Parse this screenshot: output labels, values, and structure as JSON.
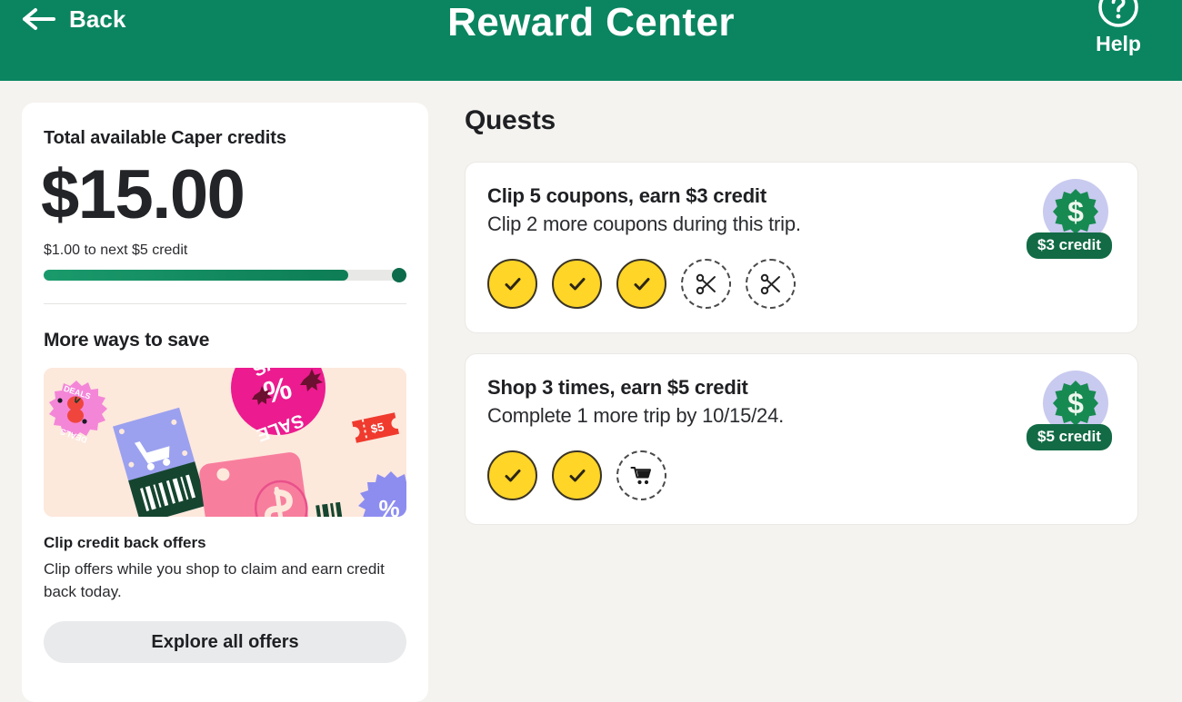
{
  "header": {
    "back_label": "Back",
    "title": "Reward Center",
    "help_label": "Help",
    "back_icon": "arrow-left-icon",
    "help_icon": "question-circle-icon",
    "background_color": "#0a8560"
  },
  "credits_card": {
    "label": "Total available Caper credits",
    "amount": "$15.00",
    "progress_caption": "$1.00 to next $5 credit",
    "progress_percent": 84,
    "progress_fill_color": "#0d7d55",
    "progress_track_color": "#e8e8e6"
  },
  "more_ways_to_save": {
    "section_title": "More ways to save",
    "illustration_name": "coupons-and-deals-illustration",
    "illustration_background": "#fde8dc",
    "offer_title": "Clip credit back offers",
    "offer_description": "Clip offers while you shop to claim and earn credit back today.",
    "button_label": "Explore all offers"
  },
  "quests": {
    "heading": "Quests",
    "items": [
      {
        "title": "Clip 5 coupons, earn $3 credit",
        "subtitle": "Clip 2 more coupons during this trip.",
        "reward_badge": "$3 credit",
        "reward_icon": "dollar-starburst-icon",
        "steps": [
          {
            "state": "done",
            "icon": "check-icon"
          },
          {
            "state": "done",
            "icon": "check-icon"
          },
          {
            "state": "done",
            "icon": "check-icon"
          },
          {
            "state": "todo",
            "icon": "scissors-icon"
          },
          {
            "state": "todo",
            "icon": "scissors-icon"
          }
        ]
      },
      {
        "title": "Shop 3 times, earn $5 credit",
        "subtitle": "Complete 1 more trip by 10/15/24.",
        "reward_badge": "$5 credit",
        "reward_icon": "dollar-starburst-icon",
        "steps": [
          {
            "state": "done",
            "icon": "check-icon"
          },
          {
            "state": "done",
            "icon": "check-icon"
          },
          {
            "state": "todo",
            "icon": "shopping-cart-icon"
          }
        ]
      }
    ]
  },
  "colors": {
    "page_background": "#f5f3ef",
    "card_background": "#ffffff",
    "accent_green": "#0a8560",
    "badge_green": "#126b45",
    "step_done_yellow": "#ffd527",
    "reward_circle_lavender": "#c9caef"
  }
}
